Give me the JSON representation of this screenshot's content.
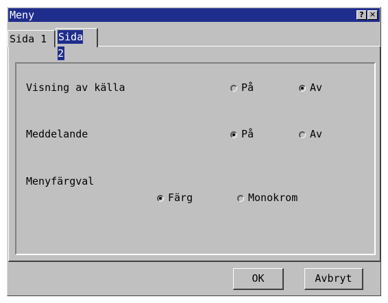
{
  "window": {
    "title": "Meny",
    "help_label": "?",
    "close_label": "✕"
  },
  "tabs": [
    {
      "label": "Sida 1",
      "selected": false
    },
    {
      "label": "Sida 2",
      "selected": true
    }
  ],
  "settings": {
    "source_display": {
      "label": "Visning av källa",
      "options": [
        "På",
        "Av"
      ],
      "selected": "Av"
    },
    "message": {
      "label": "Meddelande",
      "options": [
        "På",
        "Av"
      ],
      "selected": "På"
    },
    "menu_color": {
      "label": "Menyfärgval",
      "options": [
        "Färg",
        "Monokrom"
      ],
      "selected": "Färg"
    }
  },
  "buttons": {
    "ok": "OK",
    "cancel": "Avbryt"
  }
}
